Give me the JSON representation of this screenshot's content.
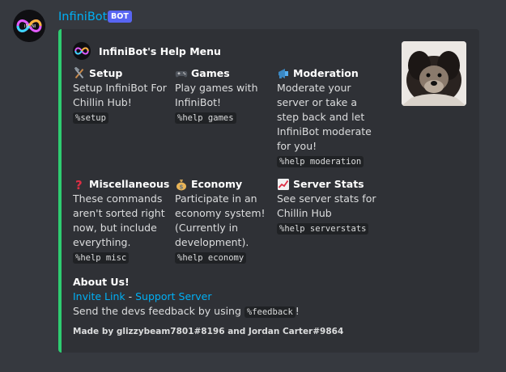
{
  "message": {
    "username": "InfiniBot",
    "bot_tag": "BOT"
  },
  "embed": {
    "accent_color": "#2ecc71",
    "author": "InfiniBot's Help Menu",
    "fields": [
      {
        "emoji": "hammer-and-wrench-icon",
        "title": "Setup",
        "desc": "Setup InfiniBot For Chillin Hub!",
        "cmd": "%setup"
      },
      {
        "emoji": "game-controller-icon",
        "title": "Games",
        "desc": "Play games with InfiniBot!",
        "cmd": "%help games"
      },
      {
        "emoji": "megaphone-icon",
        "title": "Moderation",
        "desc": "Moderate your server or take a step back and let InfiniBot moderate for you!",
        "cmd": "%help moderation"
      },
      {
        "emoji": "question-mark-icon",
        "title": "Miscellaneous",
        "desc": "These commands aren't sorted right now, but include everything.",
        "cmd": "%help misc"
      },
      {
        "emoji": "money-bag-icon",
        "title": "Economy",
        "desc": "Participate in an economy system! (Currently in development).",
        "cmd": "%help economy"
      },
      {
        "emoji": "chart-increasing-icon",
        "title": "Server Stats",
        "desc": "See server stats for Chillin Hub",
        "cmd": "%help serverstats"
      }
    ],
    "about": {
      "title": "About Us!",
      "invite_link": "Invite Link",
      "separator": " - ",
      "support_link": "Support Server",
      "feedback_text": "Send the devs feedback by using ",
      "feedback_cmd": "%feedback",
      "feedback_end": "!"
    },
    "footer": "Made by glizzybeam7801#8196 and Jordan Carter#9864"
  }
}
